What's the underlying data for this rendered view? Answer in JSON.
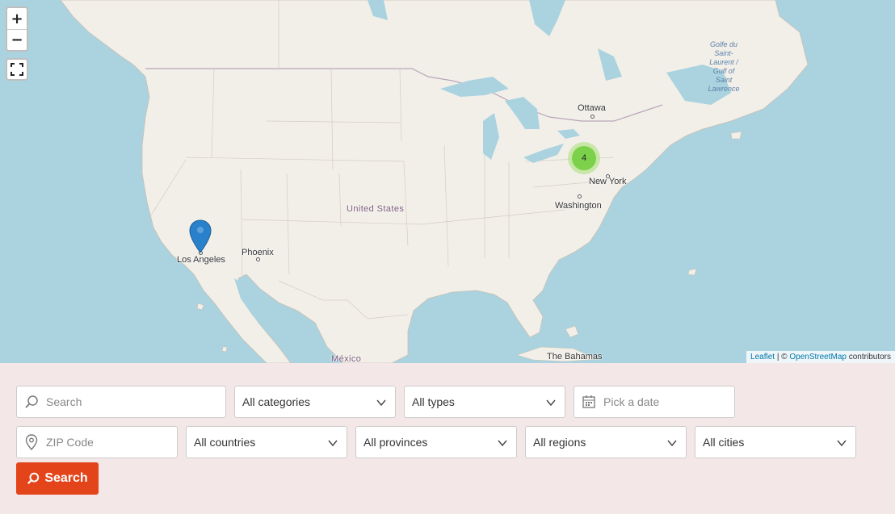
{
  "map": {
    "zoom_in": "+",
    "zoom_out": "−",
    "fullscreen_icon": "fullscreen-icon",
    "cluster_count": "4",
    "labels": {
      "ottawa": "Ottawa",
      "new_york": "New York",
      "washington": "Washington",
      "united_states": "United States",
      "phoenix": "Phoenix",
      "los_angeles": "Los Angeles",
      "mexico": "México",
      "bahamas": "The Bahamas",
      "gulf": "Golfe du Saint-Laurent / Gulf of Saint Lawrence"
    },
    "attribution": {
      "leaflet": "Leaflet",
      "sep": " | © ",
      "osm": "OpenStreetMap",
      "tail": " contributors"
    }
  },
  "filters": {
    "search_placeholder": "Search",
    "categories": "All categories",
    "types": "All types",
    "date_placeholder": "Pick a date",
    "zip_placeholder": "ZIP Code",
    "countries": "All countries",
    "provinces": "All provinces",
    "regions": "All regions",
    "cities": "All cities",
    "search_button": "Search"
  },
  "colors": {
    "water": "#aad3df",
    "land": "#f2efe9",
    "accent": "#e4441a",
    "form_bg": "#f4e7e8"
  }
}
